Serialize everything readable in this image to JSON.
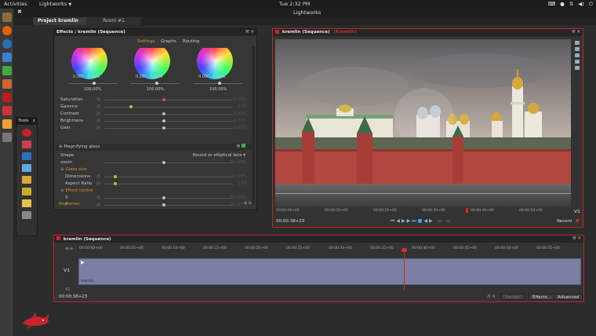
{
  "topbar": {
    "activities": "Activities",
    "app_name": "Lightworks",
    "clock": "Tue  2:32 PM"
  },
  "window": {
    "title": "Lightworks",
    "tabs": [
      "Project kremlin",
      "Room #1"
    ]
  },
  "tools_panel": {
    "title": "Tools",
    "close": "x"
  },
  "effects_panel": {
    "title": "Effects : kremlin (Sequence)",
    "subtabs": [
      "Settings",
      "Graphs",
      "Routing"
    ],
    "wheels": [
      {
        "val_a": "0.00°",
        "val_b": "0.00%",
        "pct": "100.00%"
      },
      {
        "val_a": "0.00°",
        "val_b": "0.00%",
        "pct": "100.00%"
      },
      {
        "val_a": "0.00°",
        "val_b": "0.00%",
        "pct": "100.00%"
      }
    ],
    "params": [
      {
        "label": "Saturation",
        "value": "0.00%"
      },
      {
        "label": "Gamma",
        "value": "1.00"
      },
      {
        "label": "Contrast",
        "value": "0.00%"
      },
      {
        "label": "Brightness",
        "value": "0.00%"
      },
      {
        "label": "Gain",
        "value": "0.00%"
      }
    ],
    "magnify": {
      "title": "Magnifying glass",
      "shape_label": "Shape",
      "shape_value": "Round or elliptical lens",
      "zoom_label": "zoom",
      "zoom_value": "50.00%",
      "glass_size": "Glass size",
      "dimensions_label": "Dimensions",
      "dimensions_value": "20.00%",
      "aspect_label": "Aspect Ratio",
      "aspect_value": "1.00",
      "effect_centre": "Effect centre",
      "x_label": "X",
      "x_value": "50.00%",
      "y_label": "Y",
      "y_value": "50.00%"
    },
    "footer_label": "Keyframes"
  },
  "viewer": {
    "title": "kremlin (Sequence)",
    "subtitle": "(Kremlin)",
    "timecode": "00:00:38+23",
    "ruler_labels": [
      "00:00:00+00",
      "00:00:10+00",
      "00:00:20+00",
      "00:00:30+00",
      "00:00:40+00",
      "00:00:50+00"
    ],
    "track_label": "V1",
    "record_label": "Record"
  },
  "timeline": {
    "title": "kremlin (Sequence)",
    "timecode": "00:00:38+23",
    "ruler_labels": [
      "00:00:00+00",
      "00:00:05+00",
      "00:00:10+00",
      "00:00:15+00",
      "00:00:20+00",
      "00:00:25+00",
      "00:00:30+00",
      "00:00:35+00",
      "00:00:40+00",
      "00:00:45+00",
      "00:00:50+00",
      "00:00:55+00"
    ],
    "track_v1": "V1",
    "track_a1": "A1",
    "clip_name": "kremlin",
    "buttons": {
      "render": "Render",
      "effects": "Effects...",
      "advanced": "Advanced"
    }
  },
  "colors": {
    "accent_red": "#d0262a",
    "orange": "#e08a2c",
    "clip": "#7b7fa4"
  }
}
